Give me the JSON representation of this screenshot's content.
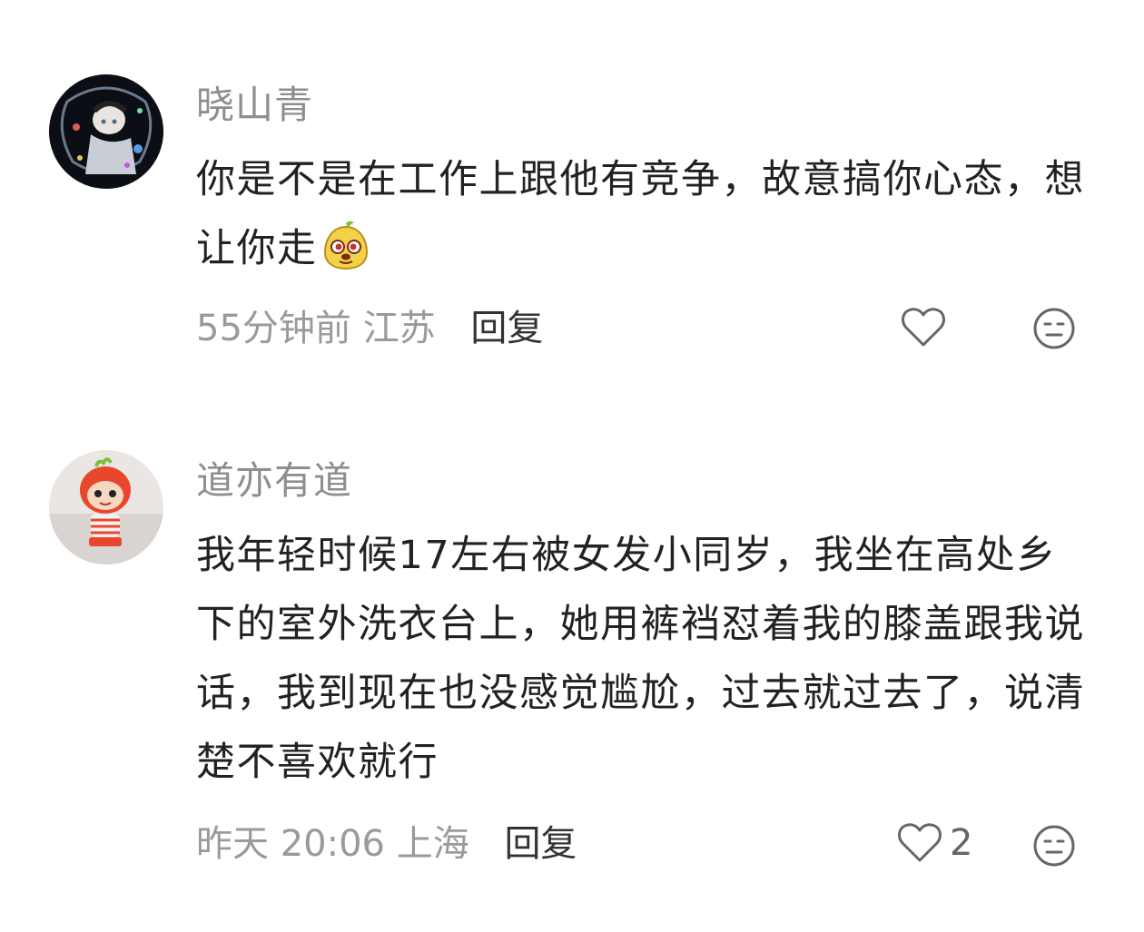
{
  "comments": [
    {
      "username": "晓山青",
      "text": "你是不是在工作上跟他有竞争，故意搞你心态，想让你走",
      "emoji": "pear-face-emoji",
      "time": "55分钟前",
      "location": "江苏",
      "reply_label": "回复",
      "like_count": "",
      "avatar": "anime-character-avatar"
    },
    {
      "username": "道亦有道",
      "text": "我年轻时候17左右被女发小同岁，我坐在高处乡下的室外洗衣台上，她用裤裆怼着我的膝盖跟我说话，我到现在也没感觉尴尬，过去就过去了，说清楚不喜欢就行",
      "time": "昨天 20:06",
      "location": "上海",
      "reply_label": "回复",
      "like_count": "2",
      "avatar": "red-doll-toy-avatar"
    }
  ],
  "icons": {
    "like": "heart-outline-icon",
    "dislike": "neutral-face-icon"
  },
  "colors": {
    "username": "#8e8e8e",
    "text": "#222222",
    "meta": "#9a9a9a",
    "icon": "#666666"
  }
}
